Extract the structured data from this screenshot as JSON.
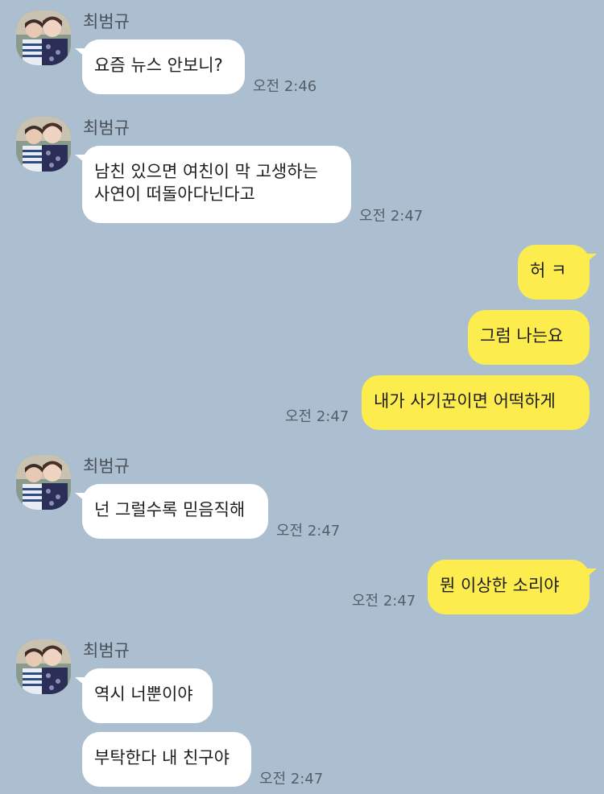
{
  "chat": {
    "sender_name": "최범규",
    "colors": {
      "background": "#acbfd0",
      "incoming_bubble": "#ffffff",
      "outgoing_bubble": "#fcec4e",
      "time_text": "#565f69"
    },
    "groups": [
      {
        "side": "incoming",
        "name": "최범규",
        "messages": [
          "요즘 뉴스 안보니?"
        ],
        "time": "오전 2:46"
      },
      {
        "side": "incoming",
        "name": "최범규",
        "messages": [
          [
            "남친 있으면 여친이 막 고생하는",
            "사연이 떠돌아다닌다고"
          ]
        ],
        "time": "오전 2:47"
      },
      {
        "side": "outgoing",
        "messages": [
          "허 ㅋ",
          "그럼 나는요",
          "내가 사기꾼이면 어떡하게"
        ],
        "time": "오전 2:47"
      },
      {
        "side": "incoming",
        "name": "최범규",
        "messages": [
          "넌 그럴수록 믿음직해"
        ],
        "time": "오전 2:47"
      },
      {
        "side": "outgoing",
        "messages": [
          "뭔 이상한 소리야"
        ],
        "time": "오전 2:47"
      },
      {
        "side": "incoming",
        "name": "최범규",
        "messages": [
          "역시 너뿐이야",
          "부탁한다 내 친구야"
        ],
        "time": "오전 2:47"
      }
    ]
  }
}
